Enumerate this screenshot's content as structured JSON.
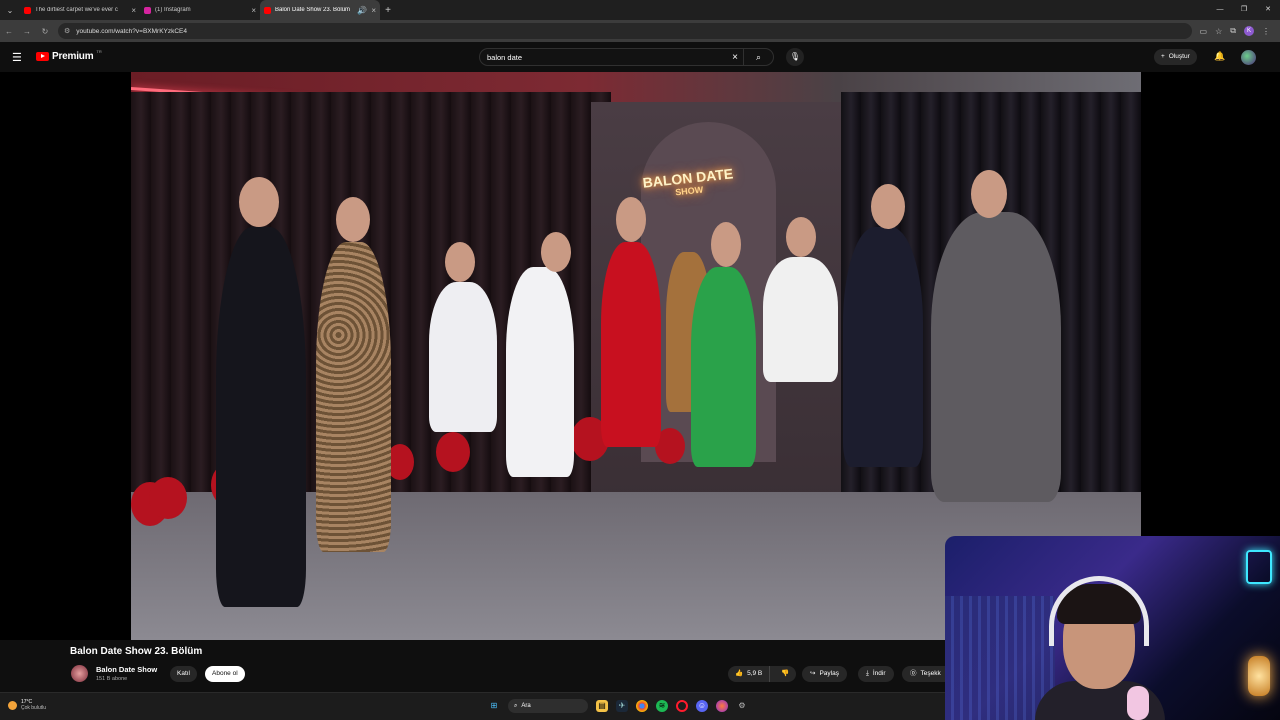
{
  "browser": {
    "tabs": [
      {
        "title": "The dirtiest carpet we've ever c",
        "color": "#ff0000",
        "active": false
      },
      {
        "title": "(1) Instagram",
        "color": "#d6249f",
        "active": false
      },
      {
        "title": "Balon Date Show 23. Bölüm",
        "color": "#ff0000",
        "active": true
      }
    ],
    "url": "youtube.com/watch?v=BXMrKYzkCE4"
  },
  "youtube": {
    "logo_text": "Premium",
    "logo_region": "TR",
    "search_query": "balon date",
    "create_label": "Oluştur"
  },
  "video": {
    "neon_line1": "BALON DATE",
    "neon_line2": "SHOW",
    "title": "Balon Date Show 23. Bölüm",
    "channel_name": "Balon Date Show",
    "subscribers": "151 B abone",
    "join_label": "Katıl",
    "subscribe_label": "Abone ol",
    "likes": "5,9 B",
    "share_label": "Paylaş",
    "download_label": "İndir",
    "thanks_label": "Teşekk"
  },
  "taskbar": {
    "temp": "17°C",
    "weather_desc": "Çok bulutlu",
    "search_label": "Ara"
  }
}
